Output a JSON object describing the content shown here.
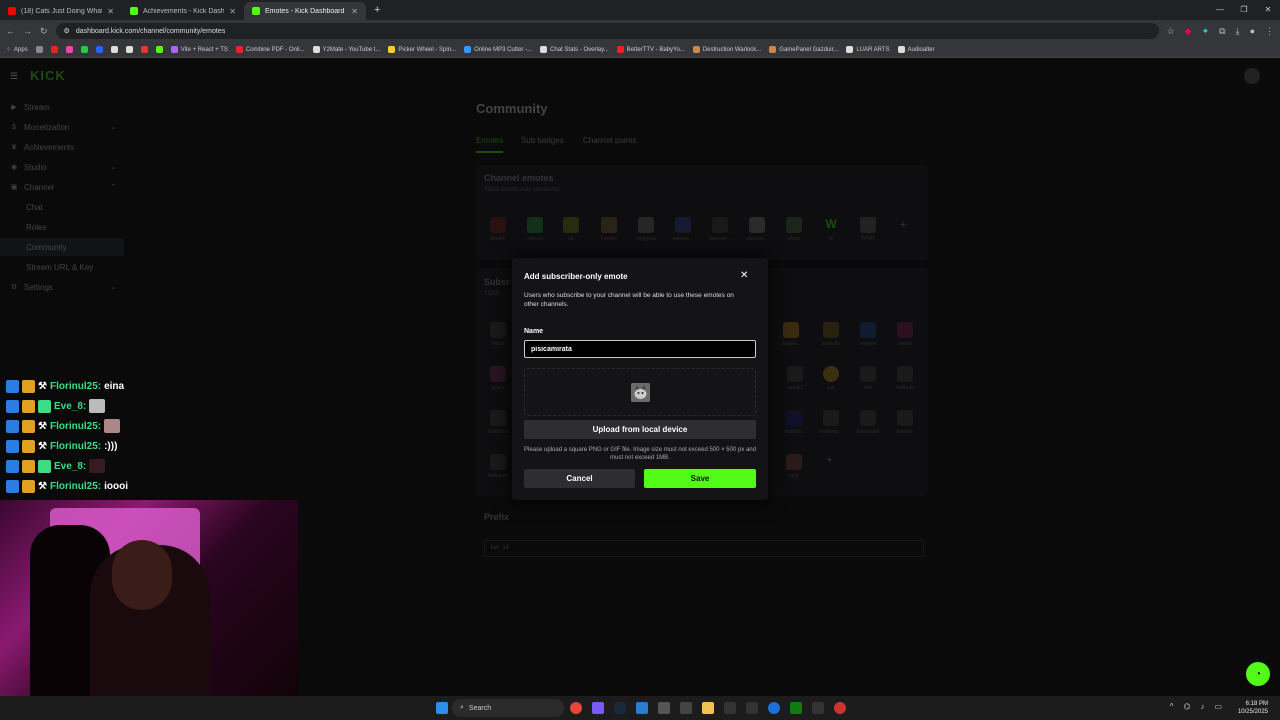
{
  "browser": {
    "tabs": [
      {
        "title": "(18) Cats Just Doing What Cats",
        "color": "#ff0000"
      },
      {
        "title": "Achievements - Kick Dashboard",
        "color": "#53fc18"
      },
      {
        "title": "Emotes - Kick Dashboard",
        "color": "#53fc18"
      }
    ],
    "new_tab": "+",
    "url": "dashboard.kick.com/channel/community/emotes",
    "bookmarks": [
      "Apps",
      "Vite + React + TS",
      "Combine PDF - Onli...",
      "Y2Mate - YouTube t...",
      "Picker Wheel - Spin...",
      "Online MP3 Cutter -...",
      "Chat Stats - Overlay...",
      "BetterTTV - BabyYo...",
      "Destruction Warlock...",
      "GamePanel Gazduir...",
      "LUAR ARTS",
      "Audioalter"
    ]
  },
  "sidebar": {
    "logo": "KICK",
    "items": [
      {
        "label": "Stream",
        "icon": "play-icon"
      },
      {
        "label": "Monetization",
        "icon": "dollar-icon",
        "chevron": "⌄"
      },
      {
        "label": "Achievements",
        "icon": "trophy-icon"
      },
      {
        "label": "Studio",
        "icon": "studio-icon",
        "chevron": "⌄"
      },
      {
        "label": "Channel",
        "icon": "channel-icon",
        "chevron": "⌃"
      },
      {
        "label": "Chat"
      },
      {
        "label": "Roles"
      },
      {
        "label": "Community"
      },
      {
        "label": "Stream URL & Key"
      },
      {
        "label": "Settings",
        "icon": "gear-icon",
        "chevron": "⌄"
      }
    ]
  },
  "main": {
    "title": "Community",
    "tabs": [
      "Emotes",
      "Sub badges",
      "Channel points"
    ],
    "channel_emotes": {
      "title": "Channel emotes",
      "subtitle": "49/60 emote slots remaining",
      "emotes": [
        "almuth",
        "ollercat",
        "CE",
        "frontflip",
        "sadgycat",
        "peepos...",
        "pepener...",
        "pisicavo...",
        "plslsk",
        "W",
        "WHAT"
      ]
    },
    "subscriber_emotes": {
      "title": "Subsc",
      "subtitle": "15/60",
      "rows": [
        [
          "tetsut",
          "lauglie...",
          "lockedin",
          "noparte",
          "nebut"
        ],
        [
          "picica",
          "sparkl2",
          "sob",
          "tedi",
          "tedibule"
        ],
        [
          "tedicelba",
          "tedimba",
          "tedinerg...",
          "tedobnsell",
          "tedrade"
        ],
        [
          "tedinoate",
          "tedy"
        ]
      ]
    },
    "prefix": {
      "label": "Prefix",
      "value": "ket_14"
    }
  },
  "modal": {
    "title": "Add subscriber-only emote",
    "description": "Users who subscribe to your channel will be able to use these emotes on other channels.",
    "name_label": "Name",
    "name_value": "pisicamirata",
    "upload_button": "Upload from local device",
    "upload_note": "Please upload a square PNG or GIF file. Image size must not exceed 500 × 500 px and must not exceed 1MB.",
    "cancel": "Cancel",
    "save": "Save",
    "accent": "#53fc18"
  },
  "chat": [
    {
      "user": "Florinul25:",
      "text": "eina"
    },
    {
      "user": "Eve_8:",
      "emote": true
    },
    {
      "user": "Florinul25:",
      "emote": true
    },
    {
      "user": "Florinul25:",
      "text": ":)))"
    },
    {
      "user": "Eve_8:",
      "emote": true
    },
    {
      "user": "Florinul25:",
      "text": "ioooi"
    }
  ],
  "taskbar": {
    "search": "Search",
    "time": "6:18 PM",
    "date": "10/25/2025"
  }
}
